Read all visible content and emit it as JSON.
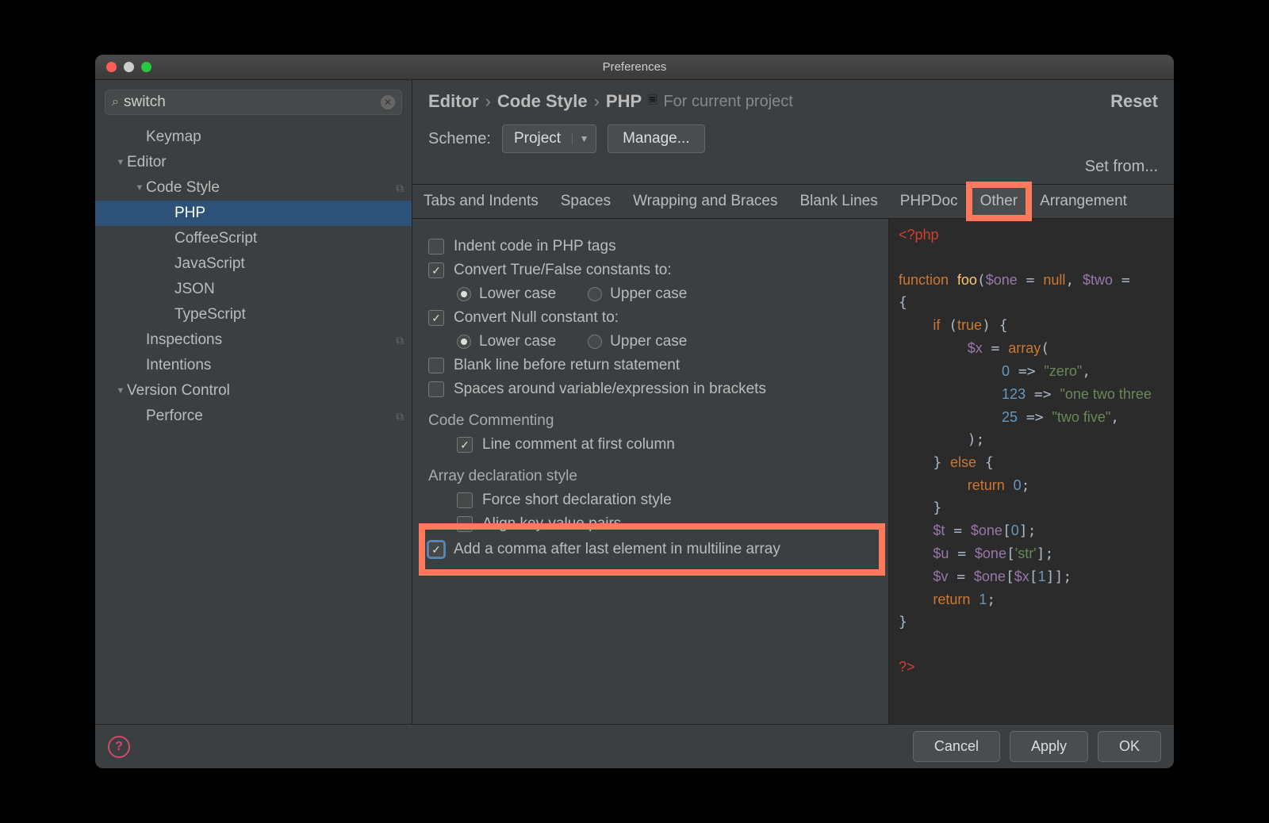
{
  "title": "Preferences",
  "search": {
    "value": "switch"
  },
  "tree": [
    {
      "label": "Keymap",
      "indent": 48,
      "arrow": ""
    },
    {
      "label": "Editor",
      "indent": 24,
      "arrow": "▼"
    },
    {
      "label": "Code Style",
      "indent": 48,
      "arrow": "▼",
      "copy": true
    },
    {
      "label": "PHP",
      "indent": 84,
      "arrow": "",
      "sel": true
    },
    {
      "label": "CoffeeScript",
      "indent": 84,
      "arrow": ""
    },
    {
      "label": "JavaScript",
      "indent": 84,
      "arrow": ""
    },
    {
      "label": "JSON",
      "indent": 84,
      "arrow": ""
    },
    {
      "label": "TypeScript",
      "indent": 84,
      "arrow": ""
    },
    {
      "label": "Inspections",
      "indent": 48,
      "arrow": "",
      "copy": true
    },
    {
      "label": "Intentions",
      "indent": 48,
      "arrow": ""
    },
    {
      "label": "Version Control",
      "indent": 24,
      "arrow": "▼"
    },
    {
      "label": "Perforce",
      "indent": 48,
      "arrow": "",
      "copy": true
    }
  ],
  "breadcrumb": {
    "a": "Editor",
    "b": "Code Style",
    "c": "PHP",
    "scope": "For current project"
  },
  "reset": "Reset",
  "scheme": {
    "label": "Scheme:",
    "value": "Project",
    "manage": "Manage...",
    "setfrom": "Set from..."
  },
  "tabs": [
    "Tabs and Indents",
    "Spaces",
    "Wrapping and Braces",
    "Blank Lines",
    "PHPDoc",
    "Other",
    "Arrangement"
  ],
  "opts": {
    "indent_php": "Indent code in PHP tags",
    "conv_tf": "Convert True/False constants to:",
    "lower": "Lower case",
    "upper": "Upper case",
    "conv_null": "Convert Null constant to:",
    "blank_return": "Blank line before return statement",
    "spaces_brackets": "Spaces around variable/expression in brackets",
    "sec_comment": "Code Commenting",
    "line_comment": "Line comment at first column",
    "sec_array": "Array declaration style",
    "force_short": "Force short declaration style",
    "align_kv": "Align key-value pairs",
    "trailing_comma": "Add a comma after last element in multiline array"
  },
  "footer": {
    "cancel": "Cancel",
    "apply": "Apply",
    "ok": "OK"
  }
}
